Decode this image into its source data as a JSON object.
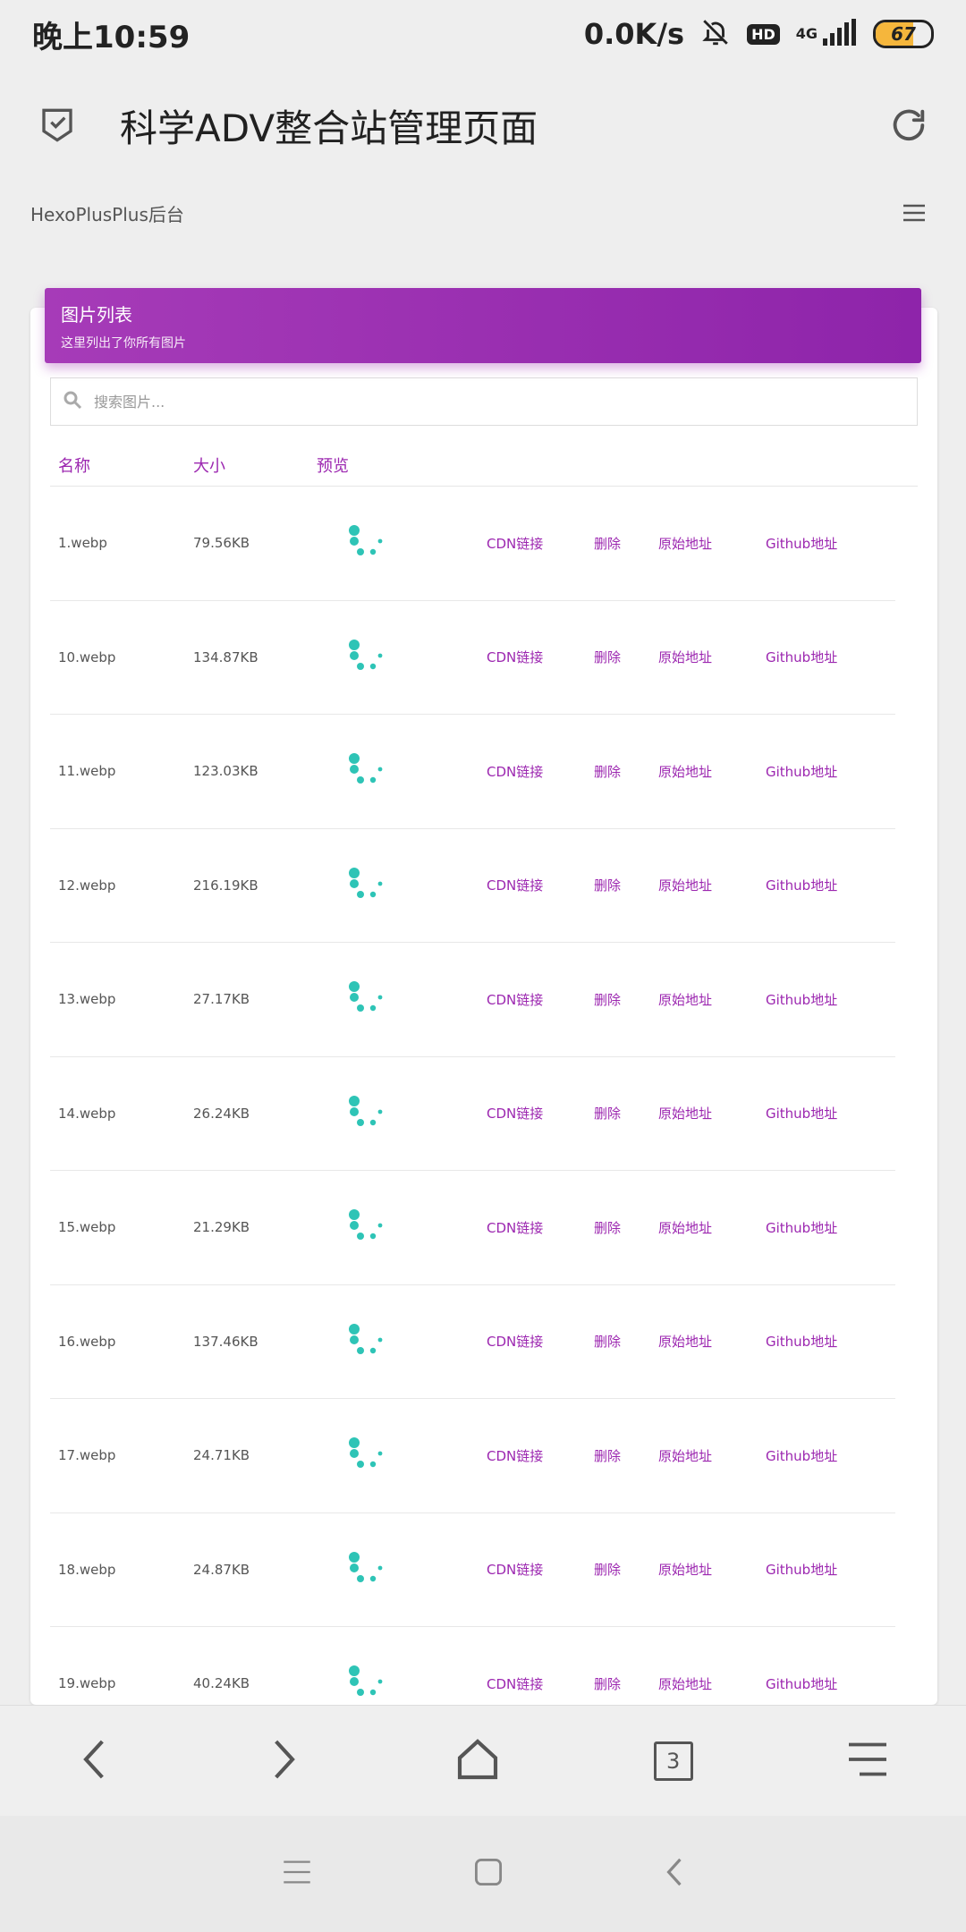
{
  "status": {
    "time": "晚上10:59",
    "net_speed": "0.0K/s",
    "hd": "HD",
    "net_type": "4G",
    "battery": "67",
    "battery_level": 0.67
  },
  "app": {
    "title": "科学ADV整合站管理页面"
  },
  "subheader": {
    "title": "HexoPlusPlus后台"
  },
  "card": {
    "title": "图片列表",
    "subtitle": "这里列出了你所有图片"
  },
  "search": {
    "placeholder": "搜索图片..."
  },
  "table": {
    "headers": {
      "name": "名称",
      "size": "大小",
      "preview": "预览"
    },
    "actions": {
      "cdn": "CDN链接",
      "delete": "删除",
      "original": "原始地址",
      "github": "Github地址"
    },
    "rows": [
      {
        "name": "1.webp",
        "size": "79.56KB"
      },
      {
        "name": "10.webp",
        "size": "134.87KB"
      },
      {
        "name": "11.webp",
        "size": "123.03KB"
      },
      {
        "name": "12.webp",
        "size": "216.19KB"
      },
      {
        "name": "13.webp",
        "size": "27.17KB"
      },
      {
        "name": "14.webp",
        "size": "26.24KB"
      },
      {
        "name": "15.webp",
        "size": "21.29KB"
      },
      {
        "name": "16.webp",
        "size": "137.46KB"
      },
      {
        "name": "17.webp",
        "size": "24.71KB"
      },
      {
        "name": "18.webp",
        "size": "24.87KB"
      },
      {
        "name": "19.webp",
        "size": "40.24KB"
      }
    ]
  },
  "browser": {
    "tab_count": "3"
  },
  "colors": {
    "accent": "#9c27b0",
    "loader": "#2ec4b6"
  },
  "icons": {
    "appbar_left": "shield-check-icon",
    "appbar_right": "refresh-icon",
    "menu": "menu-icon",
    "search": "search-icon",
    "preview": "loading-spinner-icon"
  }
}
